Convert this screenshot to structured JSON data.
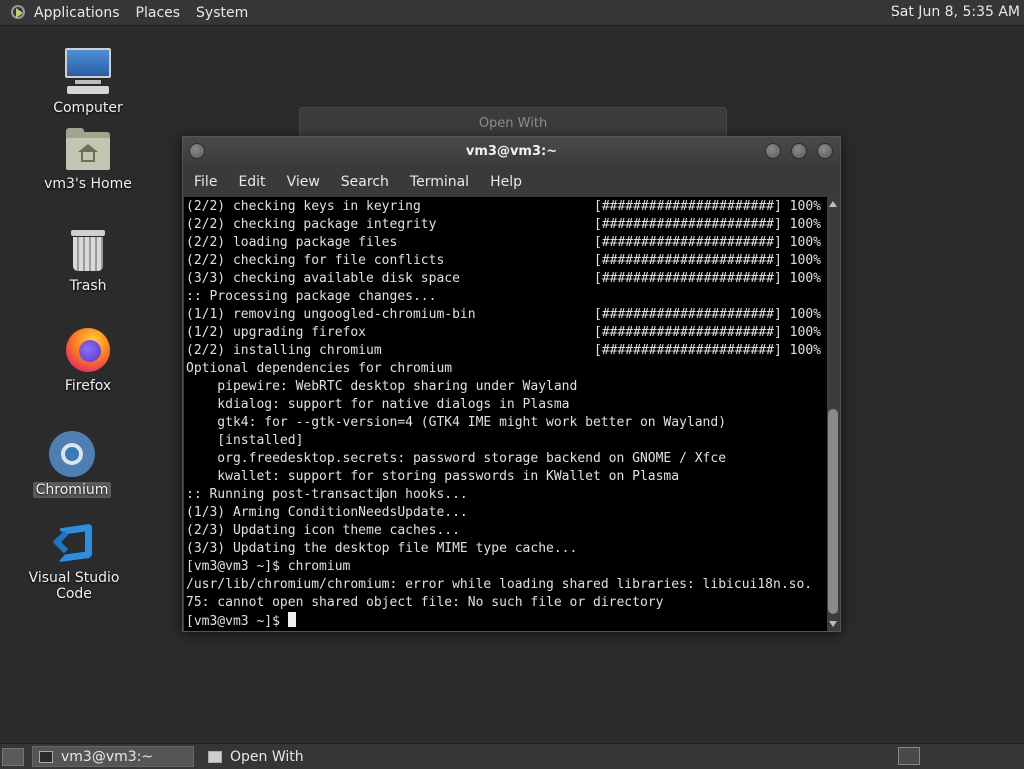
{
  "top_panel": {
    "menus": [
      "Applications",
      "Places",
      "System"
    ],
    "clock": "Sat Jun  8,  5:35 AM"
  },
  "desktop_icons": [
    {
      "label": "Computer",
      "icon": "computer-icon"
    },
    {
      "label": "vm3's Home",
      "icon": "home-folder-icon"
    },
    {
      "label": "Trash",
      "icon": "trash-icon"
    },
    {
      "label": "Firefox",
      "icon": "firefox-icon"
    },
    {
      "label": "Chromium",
      "icon": "chromium-icon",
      "selected": true
    },
    {
      "label": "Visual Studio Code",
      "icon": "vscode-icon"
    }
  ],
  "background_dialog": {
    "title": "Open With"
  },
  "terminal": {
    "title": "vm3@vm3:~",
    "menus": [
      "File",
      "Edit",
      "View",
      "Search",
      "Terminal",
      "Help"
    ],
    "lines": [
      {
        "text": "(2/2) checking keys in keyring",
        "bar": "[######################] 100%"
      },
      {
        "text": "(2/2) checking package integrity",
        "bar": "[######################] 100%"
      },
      {
        "text": "(2/2) loading package files",
        "bar": "[######################] 100%"
      },
      {
        "text": "(2/2) checking for file conflicts",
        "bar": "[######################] 100%"
      },
      {
        "text": "(3/3) checking available disk space",
        "bar": "[######################] 100%"
      },
      {
        "text": ":: Processing package changes..."
      },
      {
        "text": "(1/1) removing ungoogled-chromium-bin",
        "bar": "[######################] 100%"
      },
      {
        "text": "(1/2) upgrading firefox",
        "bar": "[######################] 100%"
      },
      {
        "text": "(2/2) installing chromium",
        "bar": "[######################] 100%"
      },
      {
        "text": "Optional dependencies for chromium"
      },
      {
        "text": "    pipewire: WebRTC desktop sharing under Wayland"
      },
      {
        "text": "    kdialog: support for native dialogs in Plasma"
      },
      {
        "text": "    gtk4: for --gtk-version=4 (GTK4 IME might work better on Wayland)"
      },
      {
        "text": "    [installed]"
      },
      {
        "text": "    org.freedesktop.secrets: password storage backend on GNOME / Xfce"
      },
      {
        "text": "    kwallet: support for storing passwords in KWallet on Plasma"
      },
      {
        "text": ":: Running post-transaction hooks..."
      },
      {
        "text": "(1/3) Arming ConditionNeedsUpdate..."
      },
      {
        "text": "(2/3) Updating icon theme caches..."
      },
      {
        "text": "(3/3) Updating the desktop file MIME type cache..."
      },
      {
        "text": "[vm3@vm3 ~]$ chromium"
      },
      {
        "text": "/usr/lib/chromium/chromium: error while loading shared libraries: libicui18n.so."
      },
      {
        "text": "75: cannot open shared object file: No such file or directory"
      }
    ],
    "prompt": "[vm3@vm3 ~]$ "
  },
  "taskbar": {
    "tasks": [
      {
        "label": "vm3@vm3:~",
        "active": true
      },
      {
        "label": "Open With",
        "active": false
      }
    ]
  }
}
